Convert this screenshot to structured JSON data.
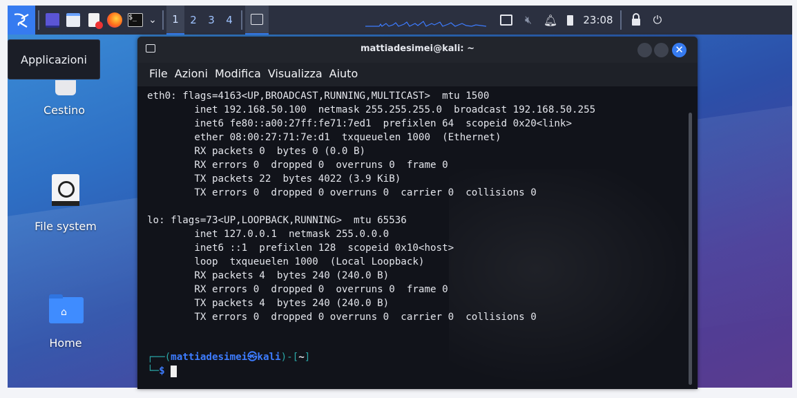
{
  "taskbar": {
    "workspaces": [
      "1",
      "2",
      "3",
      "4"
    ],
    "clock": "23:08",
    "icons": [
      "kali-menu-icon",
      "desktop-icon",
      "file-manager-icon",
      "text-editor-icon",
      "firefox-icon",
      "terminal-icon",
      "dropdown-icon",
      "terminal-task-icon",
      "screen-icon",
      "mute-icon",
      "notification-bell-icon",
      "battery-icon",
      "lock-icon",
      "logout-icon"
    ]
  },
  "tooltip": "Applicazioni",
  "desktop": {
    "trash_label": "Cestino",
    "filesystem_label": "File system",
    "home_label": "Home"
  },
  "terminal": {
    "title": "mattiadesimei@kali: ~",
    "menu": [
      "File",
      "Azioni",
      "Modifica",
      "Visualizza",
      "Aiuto"
    ],
    "output_lines": [
      "eth0: flags=4163<UP,BROADCAST,RUNNING,MULTICAST>  mtu 1500",
      "        inet 192.168.50.100  netmask 255.255.255.0  broadcast 192.168.50.255",
      "        inet6 fe80::a00:27ff:fe71:7ed1  prefixlen 64  scopeid 0x20<link>",
      "        ether 08:00:27:71:7e:d1  txqueuelen 1000  (Ethernet)",
      "        RX packets 0  bytes 0 (0.0 B)",
      "        RX errors 0  dropped 0  overruns 0  frame 0",
      "        TX packets 22  bytes 4022 (3.9 KiB)",
      "        TX errors 0  dropped 0 overruns 0  carrier 0  collisions 0",
      "",
      "lo: flags=73<UP,LOOPBACK,RUNNING>  mtu 65536",
      "        inet 127.0.0.1  netmask 255.0.0.0",
      "        inet6 ::1  prefixlen 128  scopeid 0x10<host>",
      "        loop  txqueuelen 1000  (Local Loopback)",
      "        RX packets 4  bytes 240 (240.0 B)",
      "        RX errors 0  dropped 0  overruns 0  frame 0",
      "        TX packets 4  bytes 240 (240.0 B)",
      "        TX errors 0  dropped 0 overruns 0  carrier 0  collisions 0"
    ],
    "prompt": {
      "user_host": "mattiadesimei㉿kali",
      "path": "~",
      "symbol": "$"
    }
  },
  "colors": {
    "prompt_frame": "#2aa8a8",
    "prompt_user": "#3d7cff",
    "accent": "#367bf0"
  }
}
